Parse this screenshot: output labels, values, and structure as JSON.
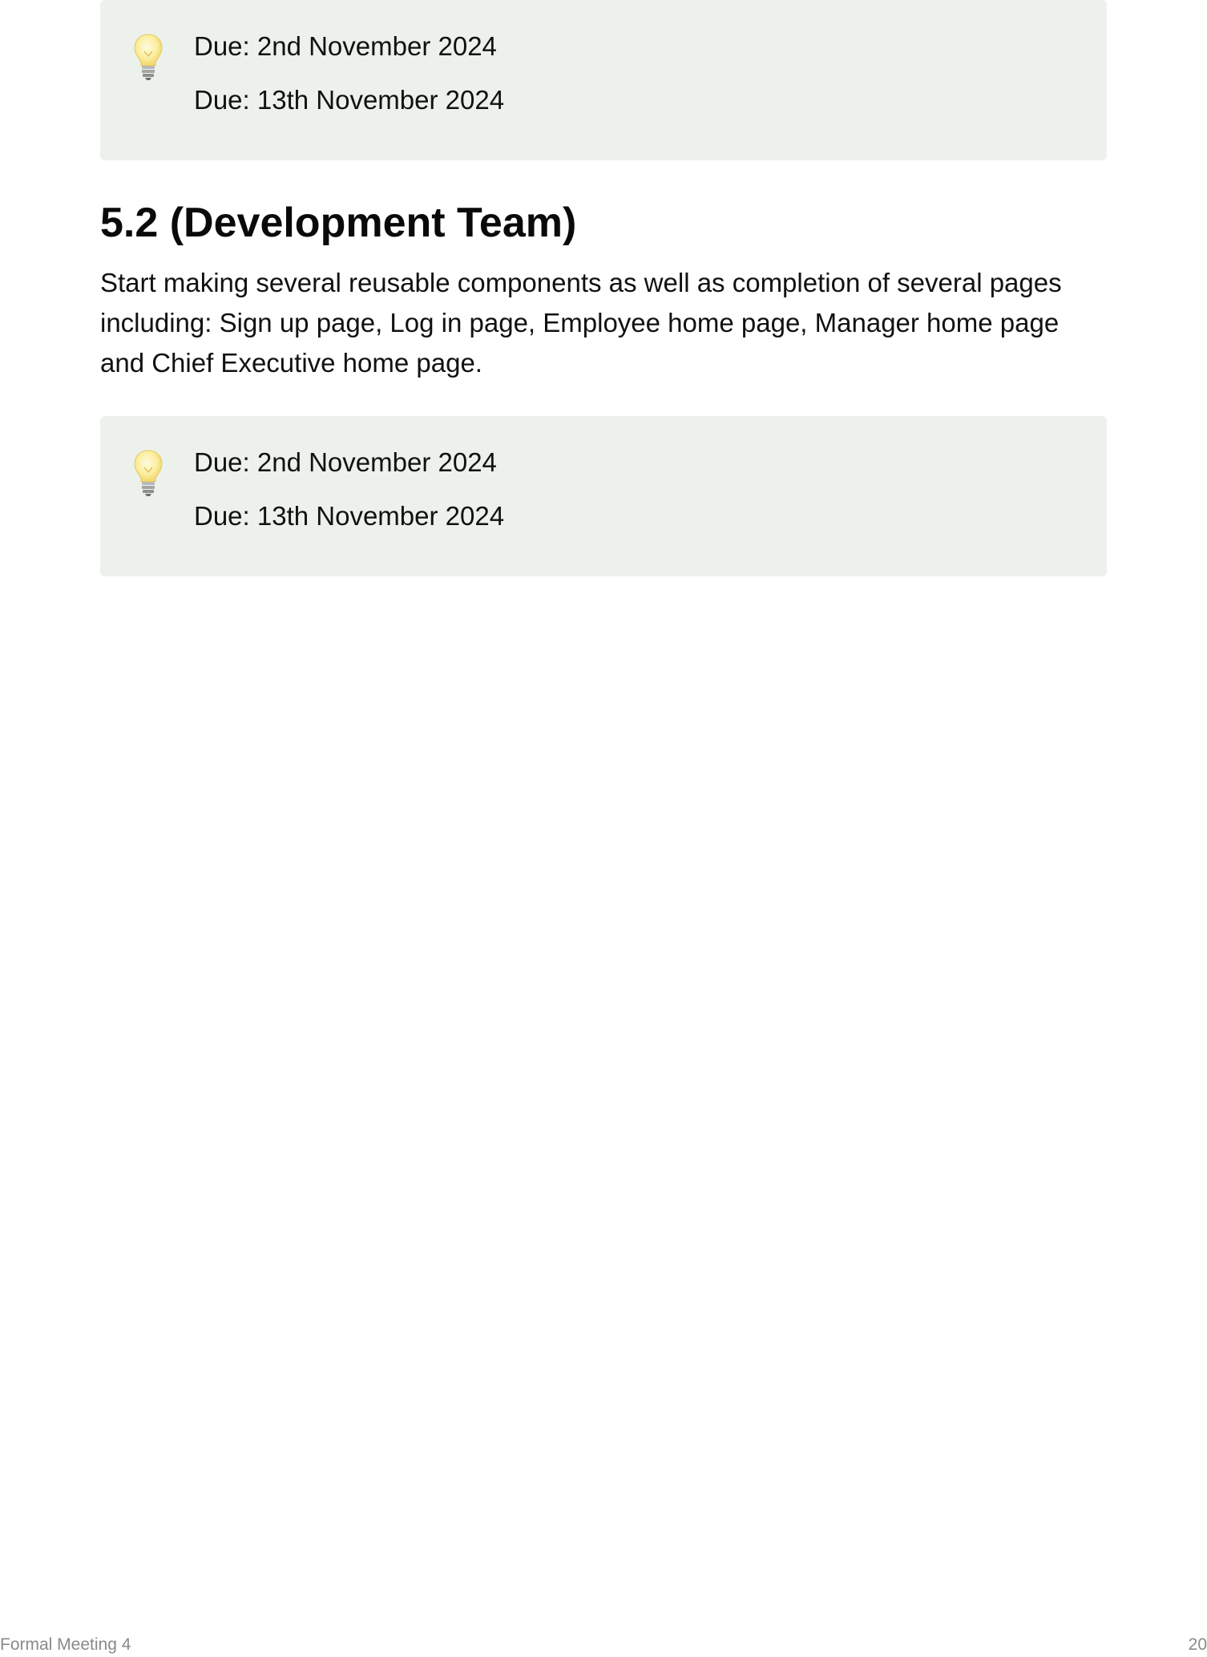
{
  "callouts": [
    {
      "icon": "lightbulb-icon",
      "lines": [
        "Due: 2nd November 2024",
        "Due: 13th November 2024"
      ]
    },
    {
      "icon": "lightbulb-icon",
      "lines": [
        "Due: 2nd November 2024",
        "Due: 13th November 2024"
      ]
    }
  ],
  "section": {
    "heading": "5.2 (Development Team)",
    "body": "Start making several reusable components as well as completion of several pages including: Sign up page, Log in page, Employee home page, Manager home page and Chief Executive home page."
  },
  "footer": {
    "title": "Formal Meeting 4",
    "page_number": "20"
  },
  "colors": {
    "callout_background": "#edf1ec",
    "text": "#111111",
    "footer_text": "#8a8a8a"
  }
}
